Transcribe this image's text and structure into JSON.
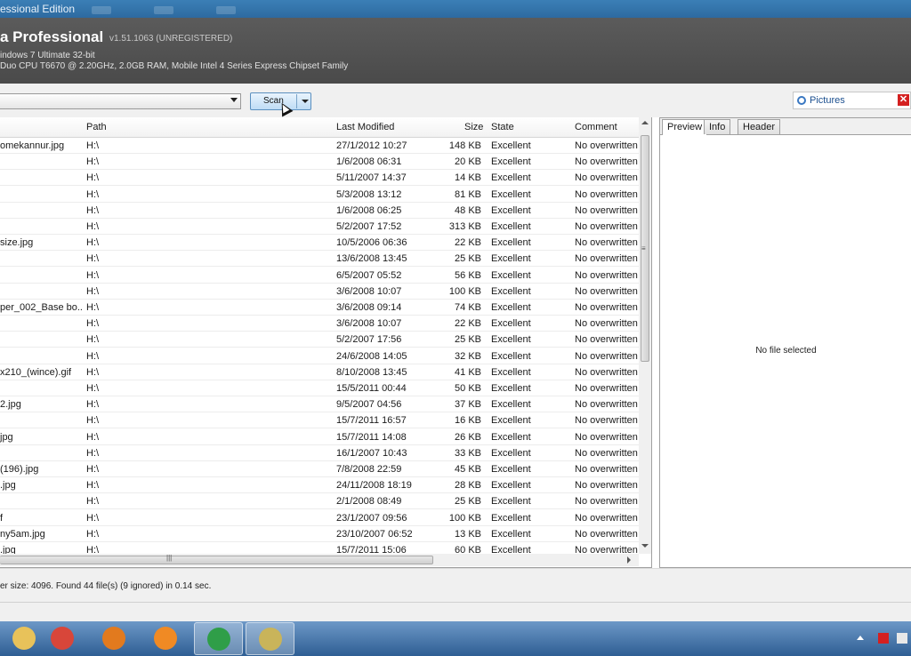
{
  "window": {
    "title": "essional Edition",
    "app_title": "a Professional",
    "version": "v1.51.1063 (UNREGISTERED)",
    "system_line1": "indows 7 Ultimate 32-bit",
    "system_line2": "Duo CPU T6670 @ 2.20GHz, 2.0GB RAM, Mobile Intel 4 Series Express Chipset Family"
  },
  "toolbar": {
    "drive_value": "",
    "scan_label": "Scan",
    "filter_value": "Pictures"
  },
  "table": {
    "columns": {
      "name": "",
      "path": "Path",
      "modified": "Last Modified",
      "size": "Size",
      "state": "State",
      "comment": "Comment"
    },
    "rows": [
      {
        "name": "omekannur.jpg",
        "path": "H:\\",
        "modified": "27/1/2012 10:27",
        "size": "148 KB",
        "state": "Excellent",
        "comment": "No overwritten"
      },
      {
        "name": "",
        "path": "H:\\",
        "modified": "1/6/2008 06:31",
        "size": "20 KB",
        "state": "Excellent",
        "comment": "No overwritten"
      },
      {
        "name": "",
        "path": "H:\\",
        "modified": "5/11/2007 14:37",
        "size": "14 KB",
        "state": "Excellent",
        "comment": "No overwritten"
      },
      {
        "name": "",
        "path": "H:\\",
        "modified": "5/3/2008 13:12",
        "size": "81 KB",
        "state": "Excellent",
        "comment": "No overwritten"
      },
      {
        "name": "",
        "path": "H:\\",
        "modified": "1/6/2008 06:25",
        "size": "48 KB",
        "state": "Excellent",
        "comment": "No overwritten"
      },
      {
        "name": "",
        "path": "H:\\",
        "modified": "5/2/2007 17:52",
        "size": "313 KB",
        "state": "Excellent",
        "comment": "No overwritten"
      },
      {
        "name": "size.jpg",
        "path": "H:\\",
        "modified": "10/5/2006 06:36",
        "size": "22 KB",
        "state": "Excellent",
        "comment": "No overwritten"
      },
      {
        "name": "",
        "path": "H:\\",
        "modified": "13/6/2008 13:45",
        "size": "25 KB",
        "state": "Excellent",
        "comment": "No overwritten"
      },
      {
        "name": "",
        "path": "H:\\",
        "modified": "6/5/2007 05:52",
        "size": "56 KB",
        "state": "Excellent",
        "comment": "No overwritten"
      },
      {
        "name": "",
        "path": "H:\\",
        "modified": "3/6/2008 10:07",
        "size": "100 KB",
        "state": "Excellent",
        "comment": "No overwritten"
      },
      {
        "name": "per_002_Base bo...",
        "path": "H:\\",
        "modified": "3/6/2008 09:14",
        "size": "74 KB",
        "state": "Excellent",
        "comment": "No overwritten"
      },
      {
        "name": "",
        "path": "H:\\",
        "modified": "3/6/2008 10:07",
        "size": "22 KB",
        "state": "Excellent",
        "comment": "No overwritten"
      },
      {
        "name": "",
        "path": "H:\\",
        "modified": "5/2/2007 17:56",
        "size": "25 KB",
        "state": "Excellent",
        "comment": "No overwritten"
      },
      {
        "name": "",
        "path": "H:\\",
        "modified": "24/6/2008 14:05",
        "size": "32 KB",
        "state": "Excellent",
        "comment": "No overwritten"
      },
      {
        "name": "x210_(wince).gif",
        "path": "H:\\",
        "modified": "8/10/2008 13:45",
        "size": "41 KB",
        "state": "Excellent",
        "comment": "No overwritten"
      },
      {
        "name": "",
        "path": "H:\\",
        "modified": "15/5/2011 00:44",
        "size": "50 KB",
        "state": "Excellent",
        "comment": "No overwritten"
      },
      {
        "name": "2.jpg",
        "path": "H:\\",
        "modified": "9/5/2007 04:56",
        "size": "37 KB",
        "state": "Excellent",
        "comment": "No overwritten"
      },
      {
        "name": "",
        "path": "H:\\",
        "modified": "15/7/2011 16:57",
        "size": "16 KB",
        "state": "Excellent",
        "comment": "No overwritten"
      },
      {
        "name": "jpg",
        "path": "H:\\",
        "modified": "15/7/2011 14:08",
        "size": "26 KB",
        "state": "Excellent",
        "comment": "No overwritten"
      },
      {
        "name": "",
        "path": "H:\\",
        "modified": "16/1/2007 10:43",
        "size": "33 KB",
        "state": "Excellent",
        "comment": "No overwritten"
      },
      {
        "name": "(196).jpg",
        "path": "H:\\",
        "modified": "7/8/2008 22:59",
        "size": "45 KB",
        "state": "Excellent",
        "comment": "No overwritten"
      },
      {
        "name": ".jpg",
        "path": "H:\\",
        "modified": "24/11/2008 18:19",
        "size": "28 KB",
        "state": "Excellent",
        "comment": "No overwritten"
      },
      {
        "name": "",
        "path": "H:\\",
        "modified": "2/1/2008 08:49",
        "size": "25 KB",
        "state": "Excellent",
        "comment": "No overwritten"
      },
      {
        "name": "f",
        "path": "H:\\",
        "modified": "23/1/2007 09:56",
        "size": "100 KB",
        "state": "Excellent",
        "comment": "No overwritten"
      },
      {
        "name": "ny5am.jpg",
        "path": "H:\\",
        "modified": "23/10/2007 06:52",
        "size": "13 KB",
        "state": "Excellent",
        "comment": "No overwritten"
      },
      {
        "name": ".jpg",
        "path": "H:\\",
        "modified": "15/7/2011 15:06",
        "size": "60 KB",
        "state": "Excellent",
        "comment": "No overwritten"
      }
    ]
  },
  "preview": {
    "tabs": [
      "Preview",
      "Info",
      "Header"
    ],
    "active_tab": "Preview",
    "empty_text": "No file selected"
  },
  "status": {
    "text": "er size: 4096. Found 44 file(s) (9 ignored) in 0.14 sec."
  },
  "taskbar": {
    "items": [
      {
        "icon": "explorer-folder-icon",
        "color": "#e8c25a"
      },
      {
        "icon": "chrome-icon",
        "color": "#d8463a"
      },
      {
        "icon": "firefox-icon",
        "color": "#e27a1e"
      },
      {
        "icon": "media-player-icon",
        "color": "#f08a24"
      },
      {
        "icon": "camtasia-icon",
        "color": "#2f9e48"
      },
      {
        "icon": "recuva-icon",
        "color": "#c9b45a"
      }
    ]
  },
  "colors": {
    "banner": "#4f4f4f",
    "accent": "#3a78c2"
  }
}
